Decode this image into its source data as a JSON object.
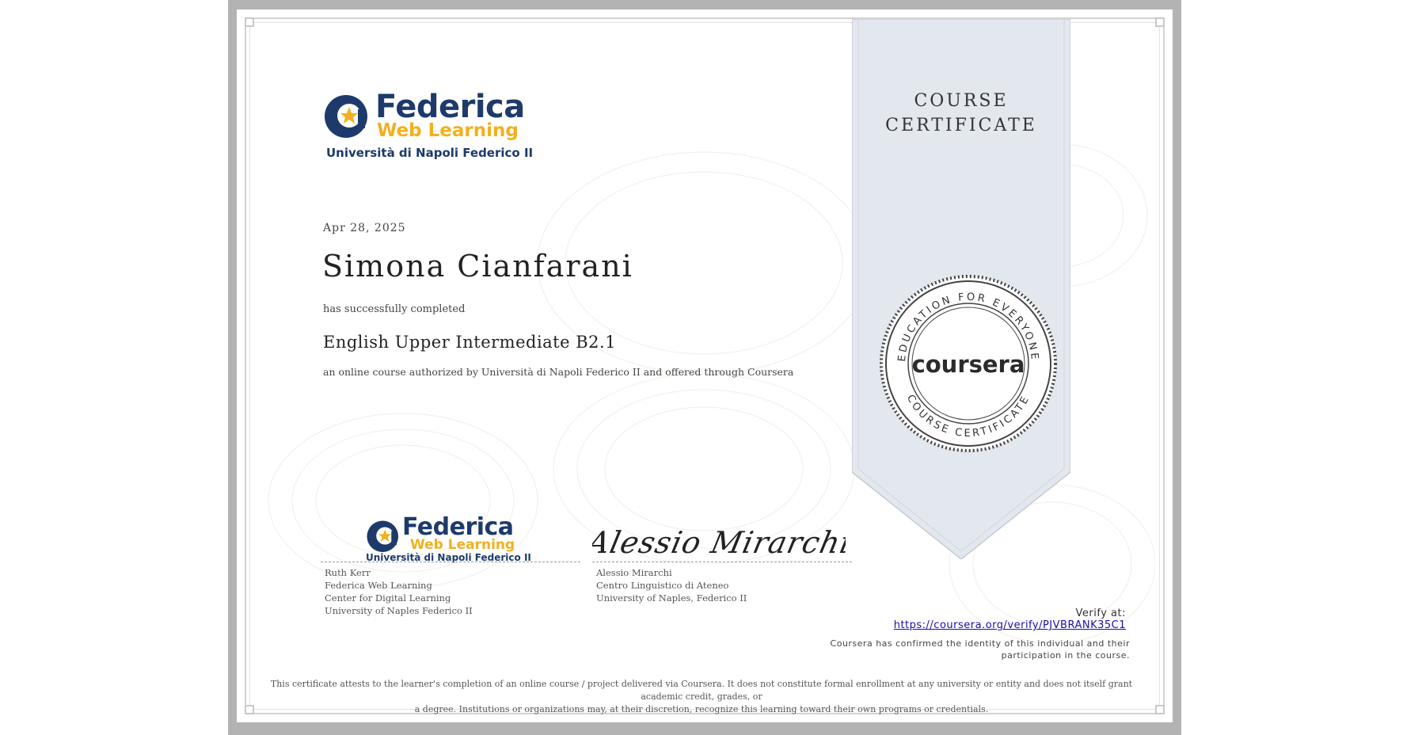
{
  "ribbon": {
    "title_line1": "COURSE",
    "title_line2": "CERTIFICATE"
  },
  "issuer_logo": {
    "brand": "Federica",
    "sub_brand": "Web Learning",
    "university": "Università di Napoli Federico II"
  },
  "certificate": {
    "date": "Apr 28, 2025",
    "recipient_name": "Simona Cianfarani",
    "completed_text": "has successfully completed",
    "course_title": "English Upper Intermediate B2.1",
    "authorization_text": "an online course authorized by Università di Napoli Federico II and offered through Coursera"
  },
  "signatories": [
    {
      "name": "Ruth Kerr",
      "line2": "Federica Web Learning",
      "line3": "Center for Digital Learning",
      "line4": "University of Naples Federico II"
    },
    {
      "signature_text": "Alessio Mirarchi",
      "name": "Alessio Mirarchi",
      "line2": "Centro Linguistico di Ateneo",
      "line3": "University of Naples, Federico II"
    }
  ],
  "seal": {
    "top_arc": "EDUCATION FOR EVERYONE",
    "bottom_arc": "COURSE CERTIFICATE",
    "brand": "coursera"
  },
  "verify": {
    "label": "Verify at:",
    "url": "https://coursera.org/verify/PJVBRANK35C1",
    "confirm_line1": "Coursera has confirmed the identity of this individual and their",
    "confirm_line2": "participation in the course."
  },
  "disclaimer": {
    "line1": "This certificate attests to the learner's completion of an online course / project delivered via Coursera. It does not constitute formal enrollment at any university or entity and does not itself grant academic credit, grades, or",
    "line2": "a degree. Institutions or organizations may, at their discretion, recognize this learning toward their own programs or credentials."
  },
  "colors": {
    "federica_navy": "#1d3a6b",
    "federica_yellow": "#f2b01e",
    "ribbon_fill": "#e3e7ee",
    "link": "#1a0dab"
  }
}
